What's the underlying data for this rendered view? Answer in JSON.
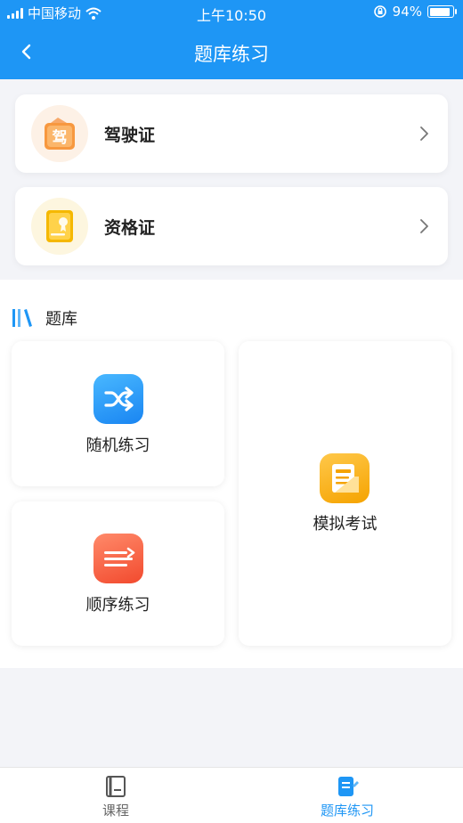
{
  "status_bar": {
    "carrier": "中国移动",
    "time": "上午10:50",
    "battery_percent": "94%",
    "battery_level": 0.94
  },
  "nav": {
    "title": "题库练习",
    "back_icon": "chevron-left-icon"
  },
  "certificates": [
    {
      "label": "驾驶证",
      "icon": "driver-license-icon",
      "icon_glyph": "驾"
    },
    {
      "label": "资格证",
      "icon": "certificate-icon"
    }
  ],
  "section": {
    "title": "题库",
    "icon": "books-icon"
  },
  "practice": {
    "random": {
      "label": "随机练习",
      "icon": "shuffle-icon"
    },
    "sequential": {
      "label": "顺序练习",
      "icon": "sequence-icon"
    },
    "mock_exam": {
      "label": "模拟考试",
      "icon": "exam-paper-icon"
    }
  },
  "tabbar": {
    "tabs": [
      {
        "label": "课程",
        "icon": "course-book-icon",
        "active": false
      },
      {
        "label": "题库练习",
        "icon": "question-bank-icon",
        "active": true
      }
    ]
  },
  "colors": {
    "primary": "#1e96f5",
    "tab_inactive": "#666666",
    "page_bg": "#f3f4f8"
  }
}
